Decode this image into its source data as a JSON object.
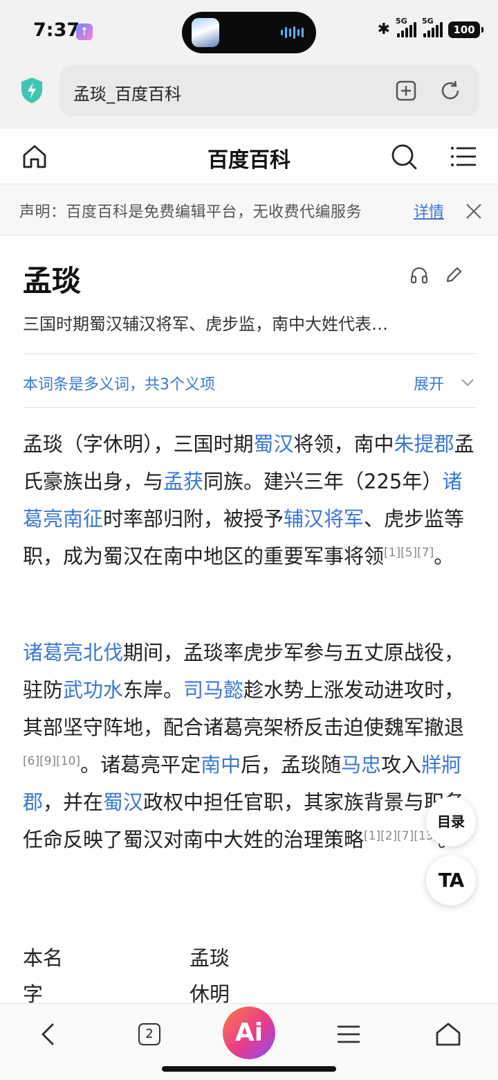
{
  "status_bar": {
    "time": "7:37",
    "signal1_label": "5G",
    "signal2_label": "5G",
    "battery": "100"
  },
  "browser": {
    "url_title": "孟琰_百度百科"
  },
  "header": {
    "title": "百度百科"
  },
  "notice": {
    "text": "声明：百度百科是免费编辑平台，无收费代编服务",
    "link": "详情"
  },
  "article": {
    "title": "孟琰",
    "subtitle": "三国时期蜀汉辅汉将军、虎步监，南中大姓代表…",
    "polysemy_text": "本词条是多义词，共3个义项",
    "polysemy_expand": "展开",
    "para1": [
      {
        "t": "孟琰（字休明），三国时期"
      },
      {
        "t": "蜀汉",
        "link": true
      },
      {
        "t": "将领，南中"
      },
      {
        "t": "朱提郡",
        "link": true
      },
      {
        "t": "孟氏豪族出身，与"
      },
      {
        "t": "孟获",
        "link": true
      },
      {
        "t": "同族。建兴三年（225年）"
      },
      {
        "t": "诸葛亮南征",
        "link": true
      },
      {
        "t": "时率部归附，被授予"
      },
      {
        "t": "辅汉将军",
        "link": true
      },
      {
        "t": "、虎步监等职，成为蜀汉在南中地区的重要军事将领"
      },
      {
        "t": "[1][5][7]",
        "sup": true
      },
      {
        "t": "。"
      }
    ],
    "para2": [
      {
        "t": "诸葛亮北伐",
        "link": true
      },
      {
        "t": "期间，孟琰率虎步军参与五丈原战役，驻防"
      },
      {
        "t": "武功水",
        "link": true
      },
      {
        "t": "东岸。"
      },
      {
        "t": "司马懿",
        "link": true
      },
      {
        "t": "趁水势上涨发动进攻时，其部坚守阵地，配合诸葛亮架桥反击迫使魏军撤退"
      },
      {
        "t": "[6][9][10]",
        "sup": true
      },
      {
        "t": "。诸葛亮平定"
      },
      {
        "t": "南中",
        "link": true
      },
      {
        "t": "后，孟琰随"
      },
      {
        "t": "马忠",
        "link": true
      },
      {
        "t": "攻入"
      },
      {
        "t": "牂牁郡",
        "link": true
      },
      {
        "t": "，并在"
      },
      {
        "t": "蜀汉",
        "link": true
      },
      {
        "t": "政权中担任官职，其家族背景与职务任命反映了蜀汉对南中大姓的治理策略"
      },
      {
        "t": "[1][2][7][13]",
        "sup": true
      },
      {
        "t": "。"
      }
    ],
    "info": [
      {
        "key": "本名",
        "value": "孟琰"
      },
      {
        "key": "字",
        "value": "休明"
      }
    ]
  },
  "floating": {
    "toc": "目录",
    "ta": "TA"
  },
  "bottom_nav": {
    "tab_count": "2",
    "ai_label": "Ai"
  }
}
